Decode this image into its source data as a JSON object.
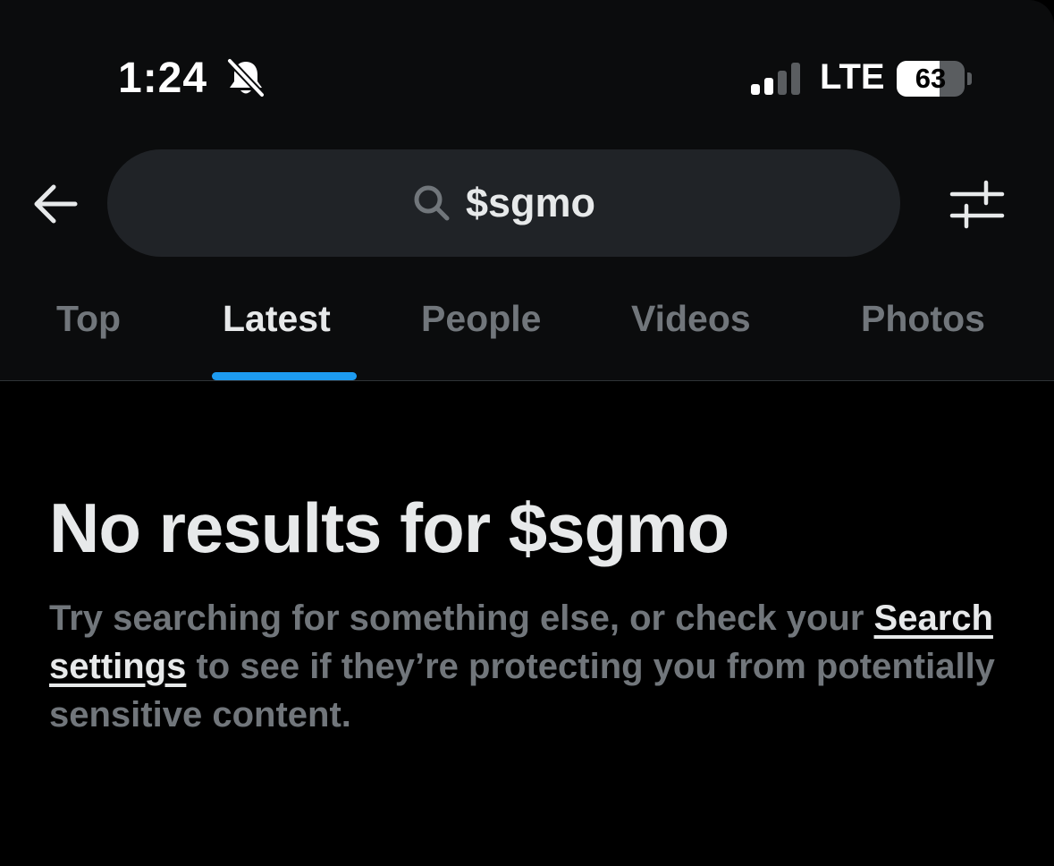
{
  "status_bar": {
    "time": "1:24",
    "mute_icon": "bell-slash-icon",
    "signal_icon": "cellular-signal-icon",
    "signal_bars_active": 2,
    "signal_bars_total": 4,
    "network": "LTE",
    "battery_level": "63",
    "battery_fraction": 0.63
  },
  "header": {
    "back_icon": "arrow-left-icon",
    "search_icon": "search-icon",
    "search_query": "$sgmo",
    "filter_icon": "sliders-icon"
  },
  "tabs": [
    {
      "label": "Top",
      "active": false
    },
    {
      "label": "Latest",
      "active": true
    },
    {
      "label": "People",
      "active": false
    },
    {
      "label": "Videos",
      "active": false
    },
    {
      "label": "Photos",
      "active": false
    }
  ],
  "empty_state": {
    "title": "No results for $sgmo",
    "body_prefix": "Try searching for something else, or check your ",
    "link_text": "Search settings",
    "body_suffix": " to see if they’re protecting you from potentially sensitive content."
  },
  "colors": {
    "background": "#000000",
    "header_background": "#0b0c0d",
    "search_box": "#202327",
    "primary_text": "#e7e9ea",
    "secondary_text": "#71767b",
    "accent": "#1d9bf0"
  }
}
